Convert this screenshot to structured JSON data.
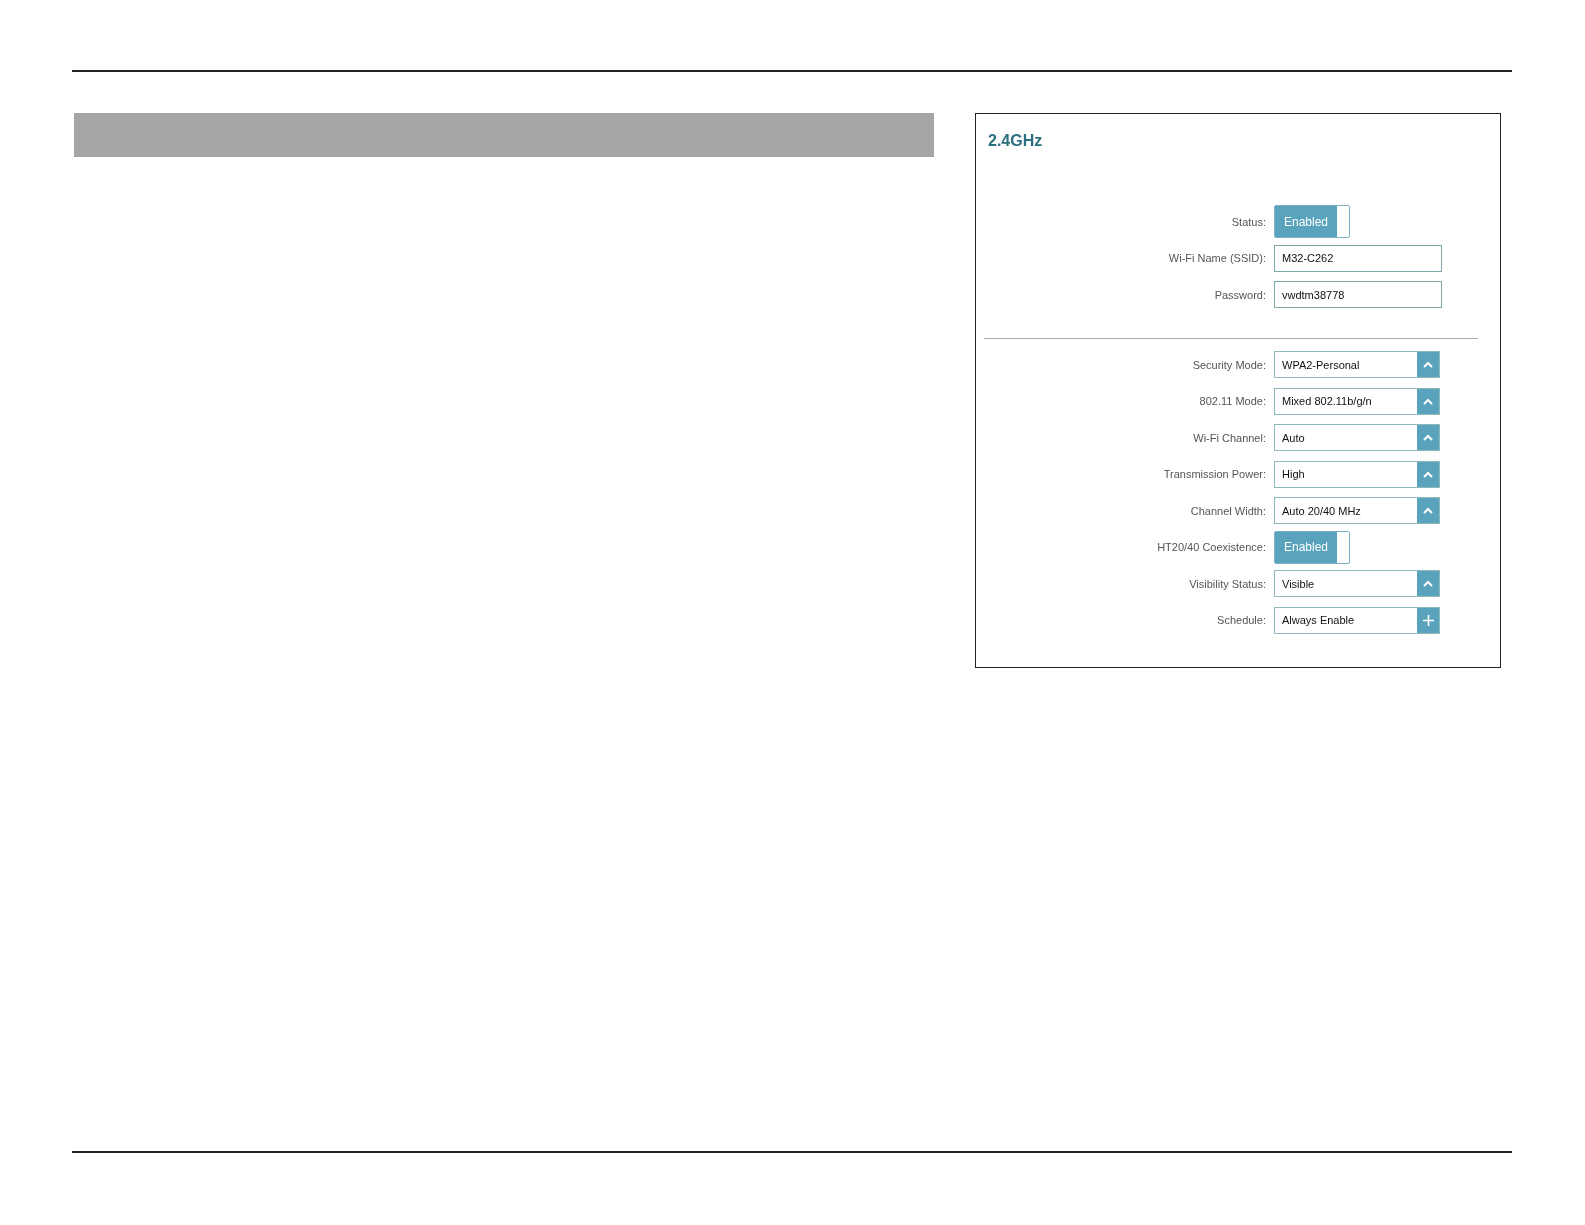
{
  "panel": {
    "title": "2.4GHz",
    "groups": [
      [
        {
          "kind": "toggle",
          "label": "Status:",
          "value": "Enabled",
          "on": true
        },
        {
          "kind": "text",
          "label": "Wi-Fi Name (SSID):",
          "value": "M32-C262"
        },
        {
          "kind": "text",
          "label": "Password:",
          "value": "vwdtm38778"
        }
      ],
      [
        {
          "kind": "select",
          "label": "Security Mode:",
          "value": "WPA2-Personal"
        },
        {
          "kind": "select",
          "label": "802.11 Mode:",
          "value": "Mixed 802.11b/g/n"
        },
        {
          "kind": "select",
          "label": "Wi-Fi Channel:",
          "value": "Auto"
        },
        {
          "kind": "select",
          "label": "Transmission Power:",
          "value": "High"
        },
        {
          "kind": "select",
          "label": "Channel Width:",
          "value": "Auto 20/40 MHz"
        },
        {
          "kind": "toggle",
          "label": "HT20/40 Coexistence:",
          "value": "Enabled",
          "on": true
        },
        {
          "kind": "select",
          "label": "Visibility Status:",
          "value": "Visible"
        },
        {
          "kind": "add",
          "label": "Schedule:",
          "value": "Always Enable"
        }
      ]
    ]
  }
}
